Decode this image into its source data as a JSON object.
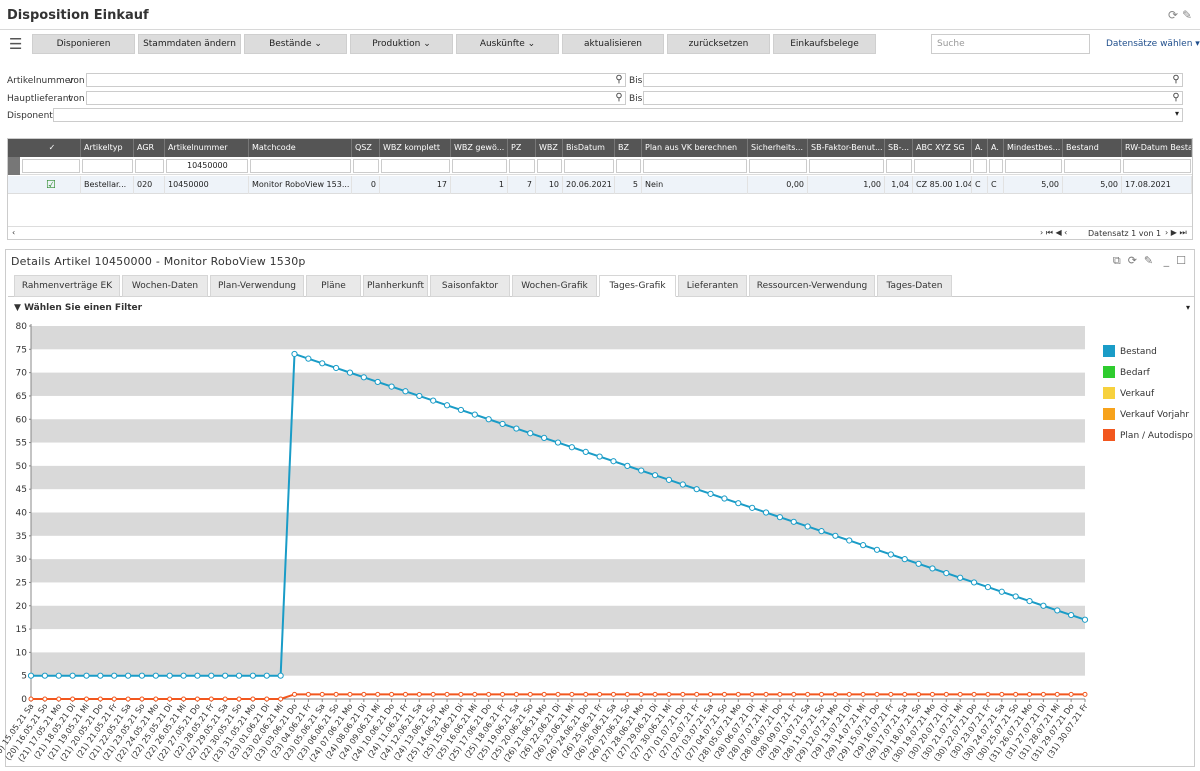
{
  "window": {
    "title": "Disposition Einkauf"
  },
  "toolbar": {
    "buttons": [
      "Disponieren",
      "Stammdaten ändern",
      "Bestände ⌄",
      "Produktion ⌄",
      "Auskünfte ⌄",
      "aktualisieren",
      "zurücksetzen",
      "Einkaufsbelege"
    ],
    "search_placeholder": "Suche",
    "records_link": "Datensätze wählen"
  },
  "filters": {
    "artikelnummer_label": "Artikelnummer",
    "von": "von",
    "bis": "Bis",
    "hauptlieferant_label": "Hauptlieferant",
    "disponent_label": "Disponent"
  },
  "grid": {
    "headers": [
      "✓",
      "Artikeltyp",
      "AGR",
      "Artikelnummer",
      "Matchcode",
      "QSZ",
      "WBZ komplett",
      "WBZ gewö...",
      "PZ",
      "WBZ",
      "BisDatum",
      "BZ",
      "Plan aus VK berechnen",
      "Sicherheits...",
      "SB-Faktor-Benut...",
      "SB-...",
      "ABC XYZ SG",
      "A.",
      "A.",
      "Mindestbes...",
      "Bestand",
      "RW-Datum Besta"
    ],
    "filter_value": "10450000",
    "row": [
      "",
      "Bestellar...",
      "020",
      "10450000",
      "Monitor RoboView 153...",
      "0",
      "17",
      "1",
      "7",
      "10",
      "20.06.2021",
      "5",
      "Nein",
      "0,00",
      "1,00",
      "1,04",
      "CZ 85.00 1.04",
      "C",
      "C",
      "5,00",
      "5,00",
      "17.08.2021"
    ],
    "footer": "Datensatz 1 von 1"
  },
  "details": {
    "title": "Details Artikel 10450000 - Monitor RoboView 1530p",
    "tabs": [
      "Rahmenverträge EK",
      "Wochen-Daten",
      "Plan-Verwendung",
      "Pläne",
      "Planherkunft",
      "Saisonfaktor",
      "Wochen-Grafik",
      "Tages-Grafik",
      "Lieferanten",
      "Ressourcen-Verwendung",
      "Tages-Daten"
    ],
    "active_tab": "Tages-Grafik",
    "filter_label": "Wählen Sie einen Filter"
  },
  "chart_data": {
    "type": "line",
    "ylim": [
      0,
      80
    ],
    "yticks": [
      0,
      5,
      10,
      15,
      20,
      25,
      30,
      35,
      40,
      45,
      50,
      55,
      60,
      65,
      70,
      75,
      80
    ],
    "x": [
      "(20) 15.05.21 Sa",
      "(20) 16.05.21 So",
      "(21) 17.05.21 Mo",
      "(21) 18.05.21 Di",
      "(21) 19.05.21 Mi",
      "(21) 20.05.21 Do",
      "(21) 21.05.21 Fr",
      "(21) 22.05.21 Sa",
      "(21) 23.05.21 So",
      "(22) 24.05.21 Mo",
      "(22) 25.05.21 Di",
      "(22) 26.05.21 Mi",
      "(22) 27.05.21 Do",
      "(22) 28.05.21 Fr",
      "(22) 29.05.21 Sa",
      "(22) 30.05.21 So",
      "(23) 31.05.21 Mo",
      "(23) 01.06.21 Di",
      "(23) 02.06.21 Mi",
      "(23) 03.06.21 Do",
      "(23) 04.06.21 Fr",
      "(23) 05.06.21 Sa",
      "(23) 06.06.21 So",
      "(24) 07.06.21 Mo",
      "(24) 08.06.21 Di",
      "(24) 09.06.21 Mi",
      "(24) 10.06.21 Do",
      "(24) 11.06.21 Fr",
      "(24) 12.06.21 Sa",
      "(24) 13.06.21 So",
      "(25) 14.06.21 Mo",
      "(25) 15.06.21 Di",
      "(25) 16.06.21 Mi",
      "(25) 17.06.21 Do",
      "(25) 18.06.21 Fr",
      "(25) 19.06.21 Sa",
      "(25) 20.06.21 So",
      "(26) 21.06.21 Mo",
      "(26) 22.06.21 Di",
      "(26) 23.06.21 Mi",
      "(26) 24.06.21 Do",
      "(26) 25.06.21 Fr",
      "(26) 26.06.21 Sa",
      "(26) 27.06.21 So",
      "(27) 28.06.21 Mo",
      "(27) 29.06.21 Di",
      "(27) 30.06.21 Mi",
      "(27) 01.07.21 Do",
      "(27) 02.07.21 Fr",
      "(27) 03.07.21 Sa",
      "(27) 04.07.21 So",
      "(28) 05.07.21 Mo",
      "(28) 06.07.21 Di",
      "(28) 07.07.21 Mi",
      "(28) 08.07.21 Do",
      "(28) 09.07.21 Fr",
      "(28) 10.07.21 Sa",
      "(28) 11.07.21 So",
      "(29) 12.07.21 Mo",
      "(29) 13.07.21 Di",
      "(29) 14.07.21 Mi",
      "(29) 15.07.21 Do",
      "(29) 16.07.21 Fr",
      "(29) 17.07.21 Sa",
      "(29) 18.07.21 So",
      "(30) 19.07.21 Mo",
      "(30) 20.07.21 Di",
      "(30) 21.07.21 Mi",
      "(30) 22.07.21 Do",
      "(30) 23.07.21 Fr",
      "(30) 24.07.21 Sa",
      "(30) 25.07.21 So",
      "(31) 26.07.21 Mo",
      "(31) 27.07.21 Di",
      "(31) 28.07.21 Mi",
      "(31) 29.07.21 Do",
      "(31) 30.07.21 Fr"
    ],
    "series": [
      {
        "name": "Bestand",
        "color": "#1a9cc7",
        "values": [
          5,
          5,
          5,
          5,
          5,
          5,
          5,
          5,
          5,
          5,
          5,
          5,
          5,
          5,
          5,
          5,
          5,
          5,
          5,
          74,
          73,
          72,
          71,
          70,
          69,
          68,
          67,
          66,
          65,
          64,
          63,
          62,
          61,
          60,
          59,
          58,
          57,
          56,
          55,
          54,
          53,
          52,
          51,
          50,
          49,
          48,
          47,
          46,
          45,
          44,
          43,
          42,
          41,
          40,
          39,
          38,
          37,
          36,
          35,
          34,
          33,
          32,
          31,
          30,
          29,
          28,
          27,
          26,
          25,
          24,
          23,
          22,
          21,
          20,
          19,
          18,
          17
        ]
      },
      {
        "name": "Bedarf",
        "color": "#2ecc2e",
        "values": []
      },
      {
        "name": "Verkauf",
        "color": "#f7d13d",
        "values": []
      },
      {
        "name": "Verkauf Vorjahr",
        "color": "#f7a21b",
        "values": []
      },
      {
        "name": "Plan / Autodispo",
        "color": "#f2571e",
        "values": [
          0,
          0,
          0,
          0,
          0,
          0,
          0,
          0,
          0,
          0,
          0,
          0,
          0,
          0,
          0,
          0,
          0,
          0,
          0,
          1,
          1,
          1,
          1,
          1,
          1,
          1,
          1,
          1,
          1,
          1,
          1,
          1,
          1,
          1,
          1,
          1,
          1,
          1,
          1,
          1,
          1,
          1,
          1,
          1,
          1,
          1,
          1,
          1,
          1,
          1,
          1,
          1,
          1,
          1,
          1,
          1,
          1,
          1,
          1,
          1,
          1,
          1,
          1,
          1,
          1,
          1,
          1,
          1,
          1,
          1,
          1,
          1,
          1,
          1,
          1,
          1,
          1
        ]
      }
    ],
    "legend": "right"
  }
}
